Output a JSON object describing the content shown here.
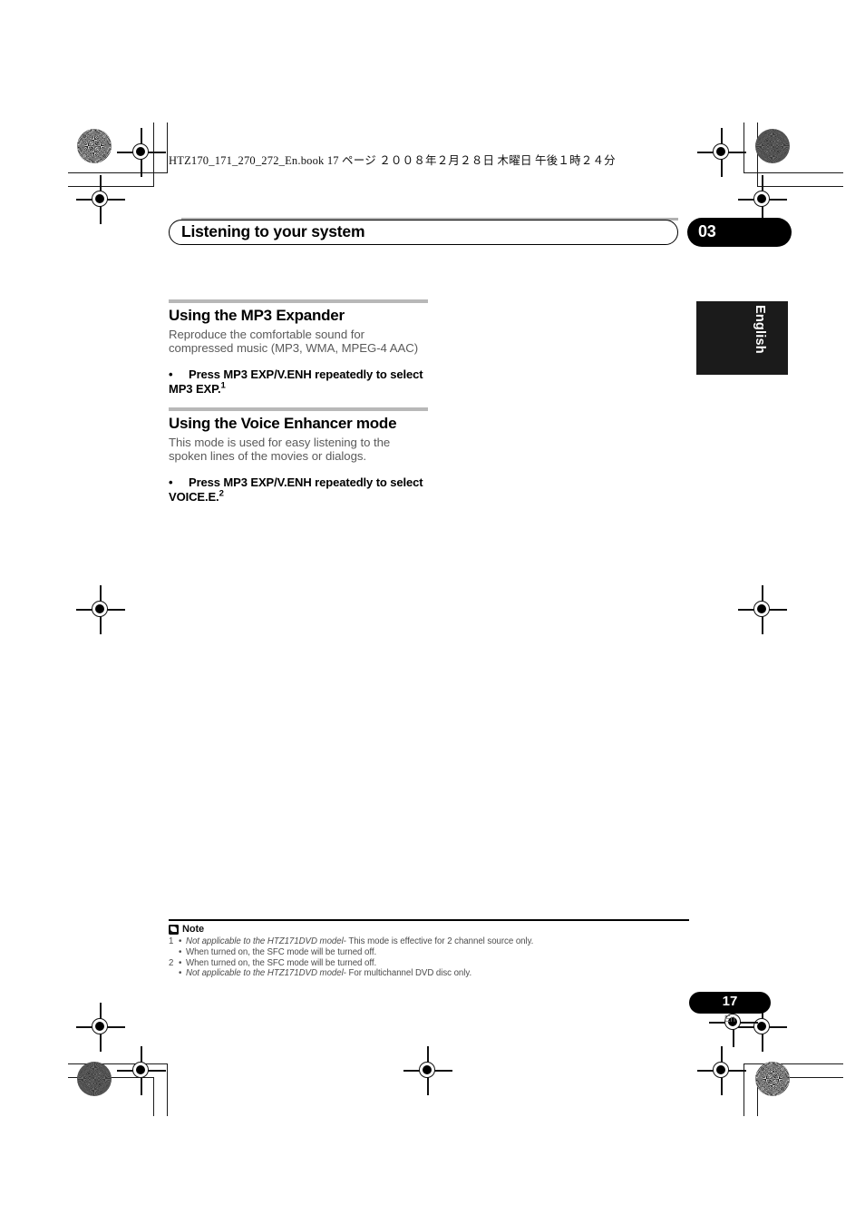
{
  "prepress": {
    "slug": "HTZ170_171_270_272_En.book   17 ページ   ２００８年２月２８日   木曜日   午後１時２４分"
  },
  "header": {
    "running_title": "Listening to your system",
    "chapter_number": "03"
  },
  "thumb_tab": {
    "language": "English"
  },
  "sections": [
    {
      "title": "Using the MP3 Expander",
      "body": "Reproduce the comfortable sound for compressed music (MP3, WMA, MPEG-4 AAC)",
      "step_bullet": "•",
      "step_text": "Press MP3 EXP/V.ENH repeatedly to select MP3 EXP.",
      "step_ref": "1"
    },
    {
      "title": "Using the Voice Enhancer mode",
      "body": "This mode is used for easy listening to the spoken lines of the movies or dialogs.",
      "step_bullet": "•",
      "step_text": "Press MP3 EXP/V.ENH repeatedly to select VOICE.E.",
      "step_ref": "2"
    }
  ],
  "note": {
    "icon": "note-icon",
    "label": "Note",
    "items": [
      {
        "index": "1",
        "bullet": "•",
        "italic": "Not applicable to the HTZ171DVD model",
        "rest": " - This mode is effective for 2 channel source only."
      },
      {
        "index": "",
        "bullet": "•",
        "italic": "",
        "rest": "When turned on, the SFC mode will be turned off."
      },
      {
        "index": "2",
        "bullet": "•",
        "italic": "",
        "rest": "When turned on, the SFC mode will be turned off."
      },
      {
        "index": "",
        "bullet": "•",
        "italic": "Not applicable to the HTZ171DVD model",
        "rest": " - For multichannel DVD disc only."
      }
    ]
  },
  "folio": {
    "page_number": "17",
    "language_code": "En"
  },
  "colors": {
    "ink_black": "#000000",
    "body_gray": "#5a5a5a",
    "rule_gray": "#b8b8b8",
    "tab_black": "#1b1b1b"
  }
}
